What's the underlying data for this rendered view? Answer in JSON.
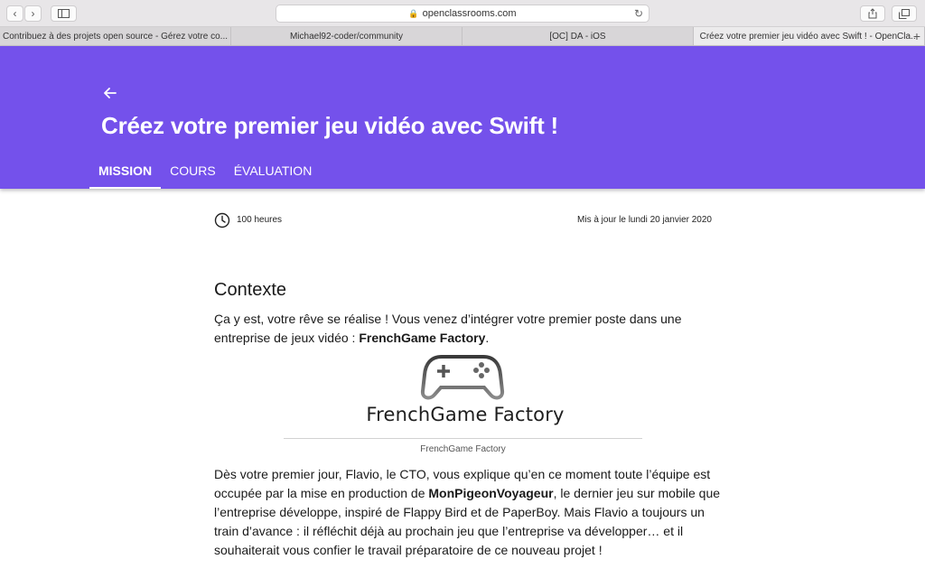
{
  "browser": {
    "url": "openclassrooms.com",
    "tabs": [
      "Contribuez à des projets open source - Gérez votre co...",
      "Michael92-coder/community",
      "[OC] DA - iOS",
      "Créez votre premier jeu vidéo avec Swift ! - OpenCla..."
    ]
  },
  "header": {
    "title": "Créez votre premier jeu vidéo avec Swift !",
    "nav": [
      "MISSION",
      "COURS",
      "ÉVALUATION"
    ],
    "active_tab": "MISSION",
    "color": "#7451eb"
  },
  "meta": {
    "duration": "100 heures",
    "updated": "Mis à jour le lundi 20 janvier 2020"
  },
  "content": {
    "heading": "Contexte",
    "intro_a": "Ça y est, votre rêve se réalise ! Vous venez d’intégrer votre premier poste dans une entreprise de jeux vidéo : ",
    "intro_bold": "FrenchGame Factory",
    "intro_end": ".",
    "logo_text": "FrenchGame Factory",
    "caption": "FrenchGame Factory",
    "p2_a": "Dès votre premier jour, Flavio, le CTO, vous explique qu’en ce moment toute l’équipe est occupée par la mise en production de ",
    "p2_bold": "MonPigeonVoyageur",
    "p2_b": ", le dernier jeu sur mobile que l’entreprise développe, inspiré de Flappy Bird et de PaperBoy. Mais Flavio a toujours un train d’avance : il réfléchit déjà au prochain jeu que l’entreprise va développer… et il souhaiterait vous confier le travail préparatoire de ce nouveau projet !"
  }
}
